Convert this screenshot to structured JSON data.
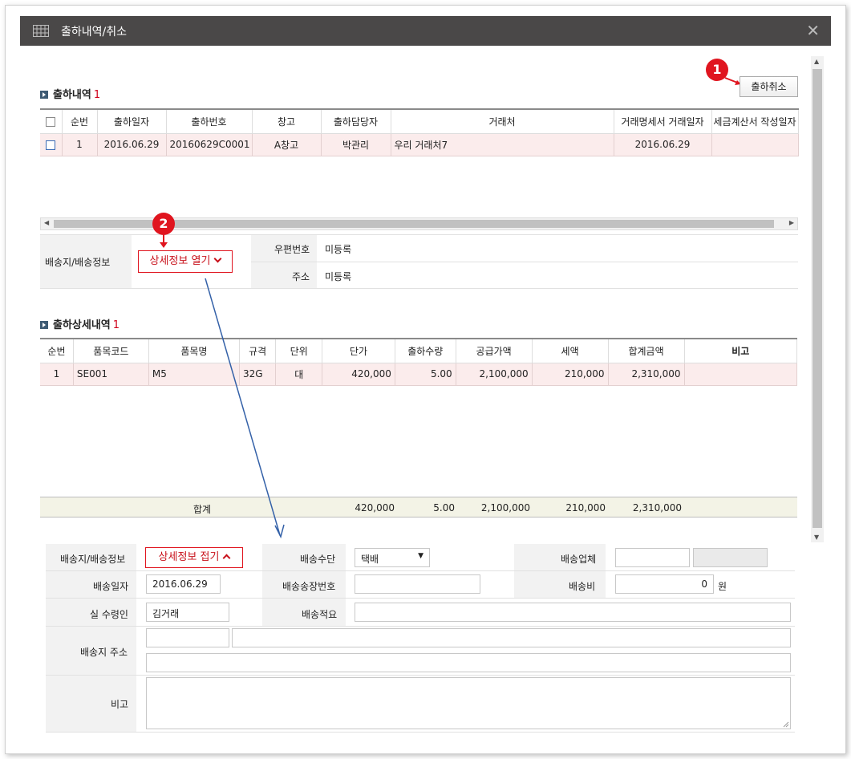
{
  "window": {
    "title": "출하내역/취소",
    "close_glyph": "✕"
  },
  "toolbar": {
    "cancel_shipment_label": "출하취소"
  },
  "badges": {
    "b1": "1",
    "b2": "2"
  },
  "shipment": {
    "title": "출하내역",
    "count": "1",
    "columns": [
      "",
      "순번",
      "출하일자",
      "출하번호",
      "창고",
      "출하담당자",
      "거래처",
      "거래명세서 거래일자",
      "세금계산서 작성일자"
    ],
    "rows": [
      {
        "no": "1",
        "date": "2016.06.29",
        "number": "20160629C0001",
        "warehouse": "A창고",
        "manager": "박관리",
        "client": "우리 거래처7",
        "statement_date": "2016.06.29",
        "invoice_date": ""
      }
    ]
  },
  "delivery_info_top": {
    "label": "배송지/배송정보",
    "toggle_label": "상세정보 열기",
    "postal_label": "우편번호",
    "postal_value": "미등록",
    "address_label": "주소",
    "address_value": "미등록"
  },
  "detail": {
    "title": "출하상세내역",
    "count": "1",
    "columns": [
      "순번",
      "품목코드",
      "품목명",
      "규격",
      "단위",
      "단가",
      "출하수량",
      "공급가액",
      "세액",
      "합계금액",
      "비고"
    ],
    "rows": [
      {
        "no": "1",
        "code": "SE001",
        "name": "M5",
        "spec": "32G",
        "unit": "대",
        "price": "420,000",
        "qty": "5.00",
        "supply": "2,100,000",
        "tax": "210,000",
        "total": "2,310,000",
        "note": ""
      }
    ],
    "sum": {
      "label": "합계",
      "price": "420,000",
      "qty": "5.00",
      "supply": "2,100,000",
      "tax": "210,000",
      "total": "2,310,000"
    }
  },
  "delivery_form": {
    "info_label": "배송지/배송정보",
    "toggle_label": "상세정보 접기",
    "method_label": "배송수단",
    "method_value": "택배",
    "carrier_label": "배송업체",
    "carrier_value": "",
    "date_label": "배송일자",
    "date_value": "2016.06.29",
    "invoice_label": "배송송장번호",
    "invoice_value": "",
    "fee_label": "배송비",
    "fee_value": "0",
    "fee_unit": "원",
    "recipient_label": "실 수령인",
    "recipient_value": "김거래",
    "memo_label": "배송적요",
    "memo_value": "",
    "address_label": "배송지 주소",
    "note_label": "비고"
  }
}
